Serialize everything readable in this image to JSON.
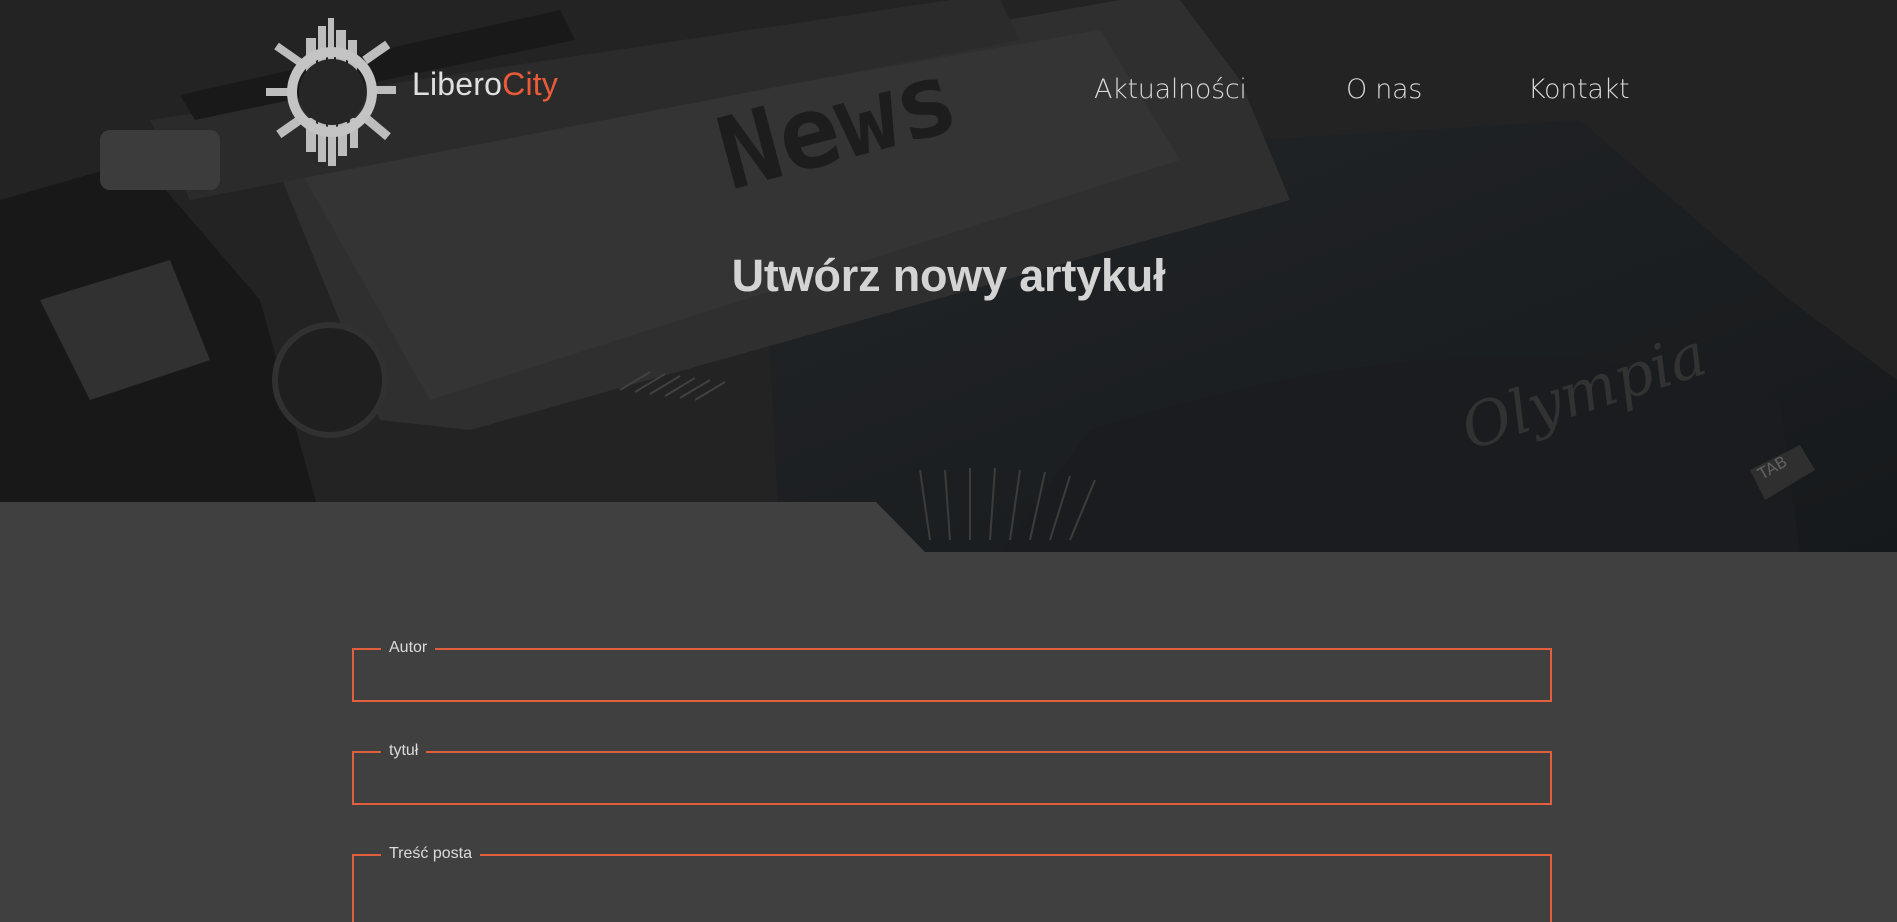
{
  "header": {
    "brand_part1": "Libero",
    "brand_part2": "City",
    "nav": [
      "Aktualności",
      "O nas",
      "Kontakt"
    ]
  },
  "hero": {
    "title": "Utwórz nowy artykuł",
    "paper_text": "News",
    "machine_brand": "Olympia",
    "key_label": "TAB"
  },
  "form": {
    "fields": [
      {
        "label": "Autor",
        "value": ""
      },
      {
        "label": "tytuł",
        "value": ""
      },
      {
        "label": "Treść posta",
        "value": ""
      }
    ]
  },
  "colors": {
    "accent": "#ec5b38",
    "page_bg": "#404040",
    "hero_bg": "#262626"
  }
}
